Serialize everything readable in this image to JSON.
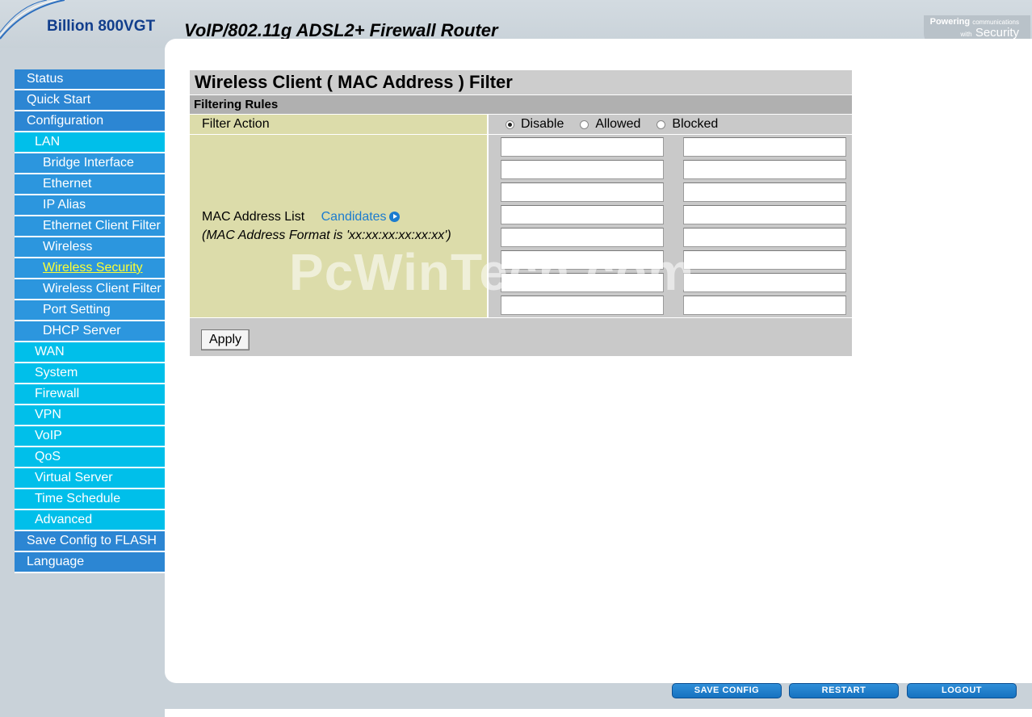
{
  "header": {
    "brand": "Billion 800VGT",
    "product_title": "VoIP/802.11g ADSL2+ Firewall Router",
    "tagline_line1_bold": "Powering",
    "tagline_line1_small": "communications",
    "tagline_line2_small": "with",
    "tagline_line2": "Security"
  },
  "sidebar": {
    "items": [
      {
        "label": "Status",
        "level": 1
      },
      {
        "label": "Quick Start",
        "level": 1
      },
      {
        "label": "Configuration",
        "level": 1
      },
      {
        "label": "LAN",
        "level": 2
      },
      {
        "label": "Bridge Interface",
        "level": 3
      },
      {
        "label": "Ethernet",
        "level": 3
      },
      {
        "label": "IP Alias",
        "level": 3
      },
      {
        "label": "Ethernet Client Filter",
        "level": 3
      },
      {
        "label": "Wireless",
        "level": 3
      },
      {
        "label": "Wireless Security",
        "level": 3,
        "active": true
      },
      {
        "label": "Wireless Client Filter",
        "level": 3
      },
      {
        "label": "Port Setting",
        "level": 3
      },
      {
        "label": "DHCP Server",
        "level": 3
      },
      {
        "label": "WAN",
        "level": 2
      },
      {
        "label": "System",
        "level": 2
      },
      {
        "label": "Firewall",
        "level": 2
      },
      {
        "label": "VPN",
        "level": 2
      },
      {
        "label": "VoIP",
        "level": 2
      },
      {
        "label": "QoS",
        "level": 2
      },
      {
        "label": "Virtual Server",
        "level": 2
      },
      {
        "label": "Time Schedule",
        "level": 2
      },
      {
        "label": "Advanced",
        "level": 2
      },
      {
        "label": "Save Config to FLASH",
        "level": 1
      },
      {
        "label": "Language",
        "level": 1
      }
    ]
  },
  "main": {
    "page_title": "Wireless Client ( MAC Address ) Filter",
    "section_title": "Filtering Rules",
    "filter_action_label": "Filter Action",
    "filter_options": [
      {
        "label": "Disable",
        "selected": true
      },
      {
        "label": "Allowed",
        "selected": false
      },
      {
        "label": "Blocked",
        "selected": false
      }
    ],
    "mac_list_label": "MAC Address List",
    "candidates_link": "Candidates",
    "format_hint": "(MAC Address Format is 'xx:xx:xx:xx:xx:xx')",
    "mac_addresses": [
      "",
      "",
      "",
      "",
      "",
      "",
      "",
      "",
      "",
      "",
      "",
      "",
      "",
      "",
      "",
      ""
    ],
    "apply_label": "Apply"
  },
  "footer": {
    "save_config_label": "SAVE CONFIG",
    "restart_label": "RESTART",
    "logout_label": "LOGOUT"
  },
  "watermark": "PcWinTech.com",
  "colors": {
    "nav_level1": "#2c86d3",
    "nav_level2": "#00bfea",
    "nav_level3": "#2c96de",
    "active_nav_text": "#ffff33",
    "label_bg": "#dcdcaa",
    "value_bg": "#c9c9c9"
  }
}
